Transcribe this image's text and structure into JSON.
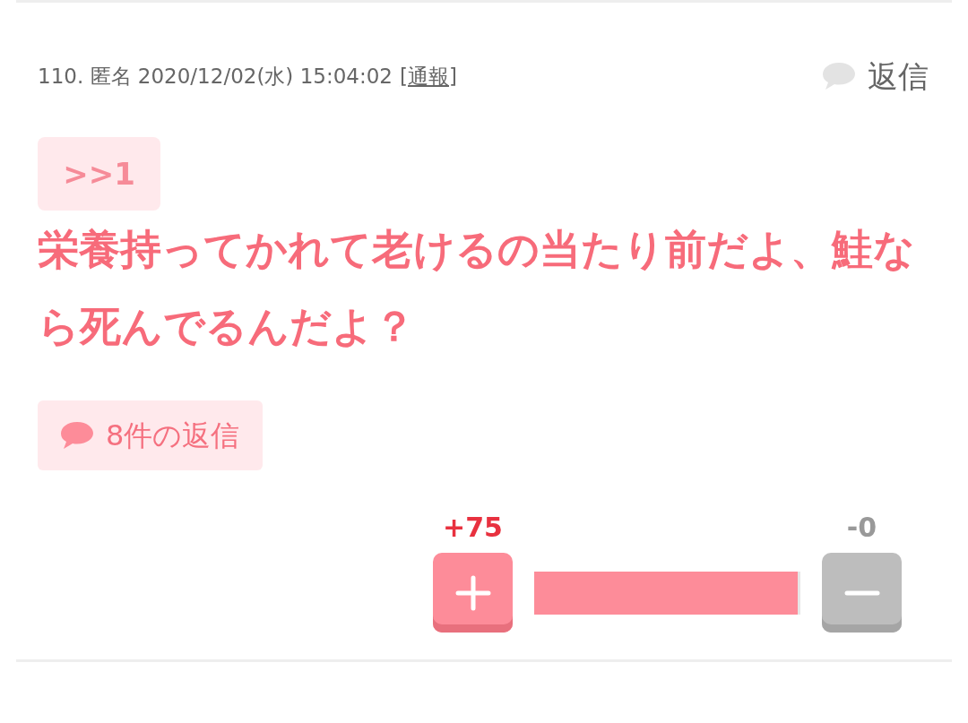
{
  "comment": {
    "meta": "110. 匿名 2020/12/02(水) 15:04:02",
    "report_link": "[通報]",
    "reply_button": "返信",
    "anchor": ">>1",
    "body": "栄養持ってかれて老けるの当たり前だよ、鮭なら死んでるんだよ？",
    "replies_button": "8件の返信"
  },
  "vote": {
    "plus_count": "+75",
    "minus_count": "-0",
    "level": 0.99
  }
}
